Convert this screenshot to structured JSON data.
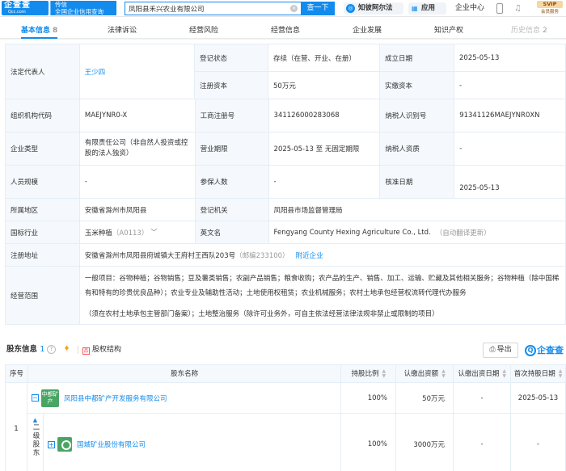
{
  "topbar": {
    "logo_main": "企查查",
    "logo_sub": "Qcc.com",
    "slogan_line1": "传信",
    "slogan_line2": "全国企业信用查询",
    "search_value": "凤阳县禾兴农业有限公司",
    "search_button": "查一下",
    "zhibi_label": "知彼阿尔法",
    "app_label": "应用",
    "enterprise_center": "企业中心",
    "svip_badge": "SVIP",
    "svip_sub": "会员服务"
  },
  "tabs": [
    {
      "label": "基本信息",
      "count": "8"
    },
    {
      "label": "法律诉讼"
    },
    {
      "label": "经营风险"
    },
    {
      "label": "经营信息"
    },
    {
      "label": "企业发展"
    },
    {
      "label": "知识产权"
    },
    {
      "label": "历史信息",
      "count": "2"
    }
  ],
  "info": {
    "legal_rep_label": "法定代表人",
    "legal_rep_value": "王少四",
    "reg_status_label": "登记状态",
    "reg_status_value": "存续（在营、开业、在册）",
    "est_date_label": "成立日期",
    "est_date_value": "2025-05-13",
    "reg_capital_label": "注册资本",
    "reg_capital_value": "50万元",
    "paid_capital_label": "实缴资本",
    "paid_capital_value": "-",
    "org_code_label": "组织机构代码",
    "org_code_value": "MAEJYNR0-X",
    "biz_reg_no_label": "工商注册号",
    "biz_reg_no_value": "341126000283068",
    "taxpayer_id_label": "纳税人识别号",
    "taxpayer_id_value": "91341126MAEJYNR0XN",
    "ent_type_label": "企业类型",
    "ent_type_value": "有限责任公司（非自然人投资或控股的法人独资）",
    "biz_term_label": "营业期限",
    "biz_term_value": "2025-05-13 至 无固定期限",
    "taxpayer_qual_label": "纳税人资质",
    "taxpayer_qual_value": "-",
    "staff_size_label": "人员规模",
    "staff_size_value": "-",
    "insured_label": "参保人数",
    "insured_value": "-",
    "approval_date_label": "核准日期",
    "approval_date_value": "2025-05-13",
    "region_label": "所属地区",
    "region_value": "安徽省滁州市凤阳县",
    "reg_authority_label": "登记机关",
    "reg_authority_value": "凤阳县市场监督管理局",
    "industry_label": "国标行业",
    "industry_value": "玉米种植",
    "industry_code": "（A0113）",
    "english_name_label": "英文名",
    "english_name_value": "Fengyang County Hexing Agriculture Co., Ltd.",
    "auto_translate": "（自动翻译更新）",
    "address_label": "注册地址",
    "address_value": "安徽省滁州市凤阳县府城镇大王府村王西队203号",
    "postcode": "（邮编233100）",
    "nearby": "附近企业",
    "scope_label": "经营范围",
    "scope_line1": "一般项目：谷物种植；谷物销售；豆及薯类销售；农副产品销售；粮食收购；农产品的生产、销售、加工、运输、贮藏及其他相关服务；谷物种植（除中国稀有和特有的珍贵优良品种）；农业专业及辅助性活动；土地使用权租赁；农业机械服务；农村土地承包经营权流转代理代办服务",
    "scope_line2": "（须在农村土地承包主管部门备案）；土地整治服务（除许可业务外，可自主依法经营法律法规非禁止或限制的项目）"
  },
  "shareholders": {
    "title": "股东信息",
    "count": "1",
    "structure_label": "股权结构",
    "export_label": "导出",
    "watermark": "企查查",
    "columns": [
      "序号",
      "股东名称",
      "持股比例",
      "认缴出资额",
      "认缴出资日期",
      "首次持股日期"
    ],
    "rows": [
      {
        "index": "1",
        "logo_text": "中都矿产",
        "name": "凤阳县中都矿产开发服务有限公司",
        "ratio": "100%",
        "amount": "50万元",
        "sub_date": "-",
        "first_date": "2025-05-13"
      },
      {
        "tier_label": "二级股东",
        "name": "国城矿业股份有限公司",
        "ratio": "100%",
        "amount": "3000万元",
        "sub_date": "-",
        "first_date": "-"
      }
    ]
  }
}
